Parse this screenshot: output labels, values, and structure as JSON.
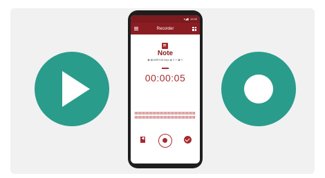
{
  "statusbar": {
    "time": "12:00"
  },
  "appbar": {
    "title": "Recorder"
  },
  "note": {
    "title": "Note",
    "info": "▣ ▤ AMR/128 kbps ◉ ↻ ⏲ ▣ ✎"
  },
  "timer": {
    "value": "00:00:05"
  },
  "colors": {
    "teal": "#2a9c8c",
    "accent": "#8b1d22",
    "red": "#a82a2e"
  }
}
